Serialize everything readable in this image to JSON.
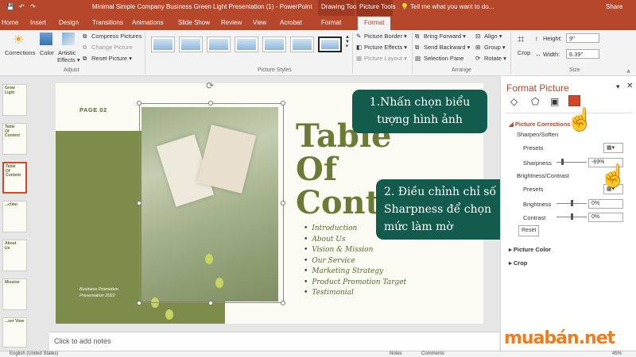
{
  "window": {
    "title": "Minimal Simple Company Business Green Light Presentation (1) - PowerPoint",
    "ctx_drawing": "Drawing Tools",
    "ctx_picture": "Picture Tools",
    "tell": "Tell me what you want to do...",
    "share": "Share"
  },
  "tabs": [
    "Home",
    "Insert",
    "Design",
    "Transitions",
    "Animations",
    "Slide Show",
    "Review",
    "View",
    "Acrobat",
    "Format",
    "Format"
  ],
  "ribbon": {
    "corrections": "Corrections",
    "color": "Color",
    "artistic": "Artistic",
    "effects": "Effects ▾",
    "compress": "Compress Pictures",
    "change": "Change Picture",
    "reset": "Reset Picture ▾",
    "adjust": "Adjust",
    "picture_styles": "Picture Styles",
    "border": "Picture Border ▾",
    "peffects": "Picture Effects ▾",
    "layout": "Picture Layout ▾",
    "bring": "Bring Forward ▾",
    "send": "Send Backward ▾",
    "selpane": "Selection Pane",
    "align": "Align ▾",
    "group": "Group ▾",
    "rotate": "Rotate ▾",
    "arrange": "Arrange",
    "crop": "Crop",
    "height_label": "Height:",
    "height": "9\"",
    "width_label": "Width:",
    "width": "6.39\"",
    "size": "Size"
  },
  "slide": {
    "page": "PAGE 02",
    "toc": [
      "Table",
      "Of",
      "Conte"
    ],
    "items": [
      "Introduction",
      "About Us",
      "Vision & Mission",
      "Our Service",
      "Marketing Strategy",
      "Product Promotion Target",
      "Testimonial"
    ],
    "promo": [
      "Business Promotion",
      "Presentation 2022"
    ]
  },
  "thumbs": [
    [
      "Grow",
      "Light"
    ],
    [
      "Table",
      "Of",
      "Content"
    ],
    [
      "Table",
      "Of",
      "Content"
    ],
    [
      "...ction"
    ],
    [
      "About",
      "Us"
    ],
    [
      "Mission"
    ],
    [
      "...ser View"
    ]
  ],
  "callouts": {
    "c1": [
      "1.Nhấn chọn biểu",
      "tượng hình ảnh"
    ],
    "c2": [
      "2. Điều chỉnh chỉ số",
      "Sharpness để chọn",
      "mức làm mờ"
    ]
  },
  "notes": "Click to add notes",
  "pane": {
    "title": "Format Picture",
    "corrections": "Picture Corrections",
    "sharpen": "Sharpen/Soften",
    "presets": "Presets",
    "sharpness": "Sharpness",
    "sharpness_val": "-69%",
    "bc": "Brightness/Contrast",
    "presets2": "Presets",
    "brightness": "Brightness",
    "brightness_val": "0%",
    "contrast": "Contrast",
    "contrast_val": "0%",
    "reset": "Reset",
    "color": "Picture Color",
    "crop": "Crop"
  },
  "status": {
    "lang": "English (United States)",
    "notes": "Notes",
    "comments": "Comments",
    "zoom": "45%"
  },
  "watermark": "muabán.net",
  "colors": {
    "accent": "#b7472a",
    "olive": "#7d8c4a",
    "callout": "#135b4d"
  }
}
